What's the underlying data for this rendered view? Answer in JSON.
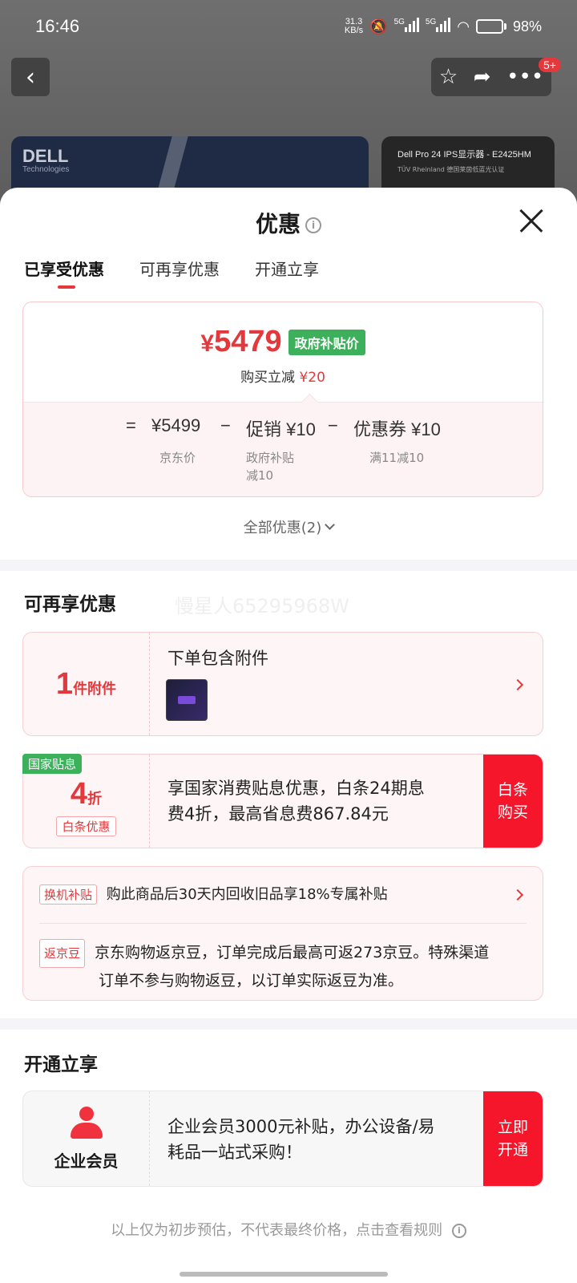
{
  "status_bar": {
    "time": "16:46",
    "net_speed_value": "31.3",
    "net_speed_unit": "KB/s",
    "sig1": "5G",
    "sig2": "5G",
    "battery": "98%",
    "battery_level": 0.98
  },
  "background": {
    "badge": "5+",
    "dell_brand": "DELL",
    "dell_sub": "Technologies",
    "monitor_title": "Dell Pro 24 IPS显示器 - E2425HM",
    "monitor_sub": "TÜV Rheinland 德国莱茵低蓝光认证"
  },
  "sheet": {
    "title": "优惠",
    "tabs": [
      {
        "label": "已享受优惠"
      },
      {
        "label": "可再享优惠"
      },
      {
        "label": "开通立享"
      }
    ]
  },
  "price_card": {
    "currency": "¥",
    "final_price": "5479",
    "gov_tag": "政府补贴价",
    "reduce_label": "购买立减",
    "reduce_amount": "¥20",
    "eq": "=",
    "base_price": "¥5499",
    "minus1": "−",
    "promo_label": "促销",
    "promo_amount": "¥10",
    "minus2": "−",
    "coupon_label": "优惠券",
    "coupon_amount": "¥10",
    "base_desc": "京东价",
    "promo_desc_1": "政府补贴",
    "promo_desc_2": "减10",
    "coupon_desc": "满11减10"
  },
  "all_offers": "全部优惠(2)",
  "more_section": {
    "title": "可再享优惠",
    "watermark": "慢星人65295968W",
    "accessory": {
      "num": "1",
      "unit": "件附件",
      "text": "下单包含附件"
    },
    "interest": {
      "tag": "国家贴息",
      "num": "4",
      "unit": "折",
      "sub_tag": "白条优惠",
      "text_1": "享国家消费贴息优惠，白条24期息",
      "text_2": "费4折，最高省息费867.84元",
      "btn_1": "白条",
      "btn_2": "购买"
    },
    "tradein": {
      "tag": "换机补贴",
      "text": "购此商品后30天内回收旧品享18%专属补贴"
    },
    "jingdou": {
      "tag": "返京豆",
      "text_1": "京东购物返京豆，订单完成后最高可返273京豆。特殊渠道",
      "text_2": "订单不参与购物返豆，以订单实际返豆为准。"
    }
  },
  "open_section": {
    "title": "开通立享",
    "member_label": "企业会员",
    "text_1": "企业会员3000元补贴，办公设备/易",
    "text_2": "耗品一站式采购！",
    "btn_1": "立即",
    "btn_2": "开通"
  },
  "footnote": "以上仅为初步预估，不代表最终价格，点击查看规则"
}
